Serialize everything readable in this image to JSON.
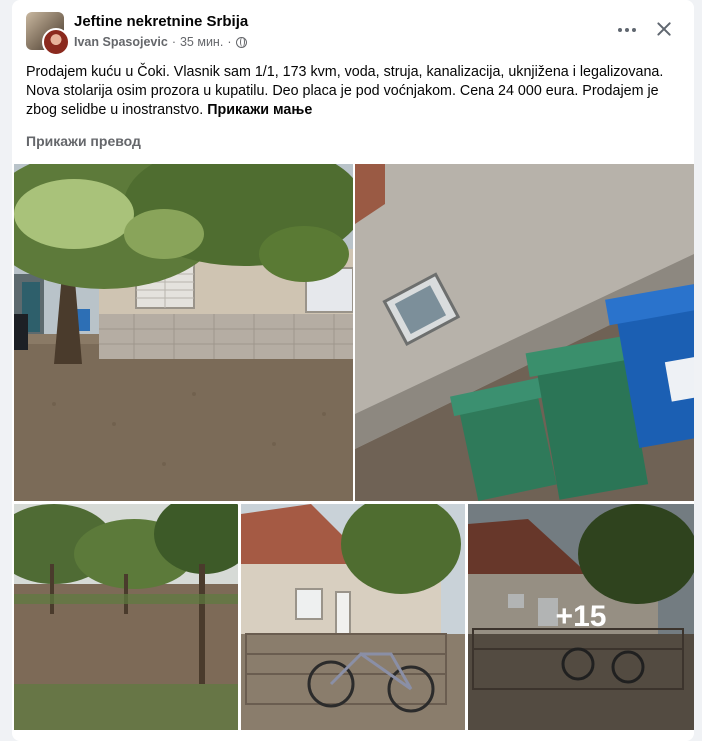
{
  "post": {
    "group_name": "Jeftine nekretnine Srbija",
    "author": "Ivan Spasojevic",
    "separator": "·",
    "time": "35 мин.",
    "separator2": "·",
    "body_text": "Prodajem kuću u Čoki. Vlasnik sam 1/1, 173 kvm, voda, struja, kanalizacija, uknjižena i legalizovana. Nova stolarija osim prozora u kupatilu. Deo placa je pod voćnjakom. Cena 24 000 eura. Prodajem je zbog selidbe u inostranstvo.",
    "show_less": "Прикажи мање",
    "translate": "Прикажи превод",
    "more_photos": "+15"
  },
  "icons": {
    "privacy": "globe-icon",
    "more": "more-options-icon",
    "close": "close-icon"
  },
  "colors": {
    "background": "#f0f2f5",
    "card": "#ffffff",
    "secondary_text": "#65676b"
  }
}
